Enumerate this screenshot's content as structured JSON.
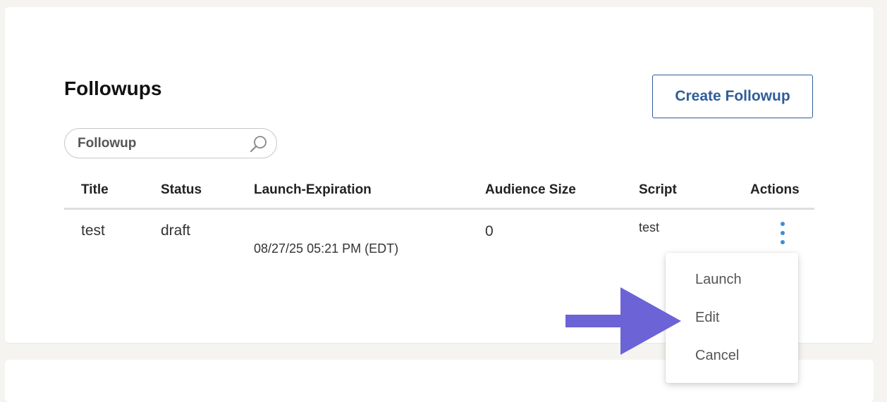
{
  "page": {
    "title": "Followups",
    "create_button_label": "Create Followup"
  },
  "search": {
    "placeholder": "Followup"
  },
  "table": {
    "columns": [
      "Title",
      "Status",
      "Launch-Expiration",
      "Audience Size",
      "Script",
      "Actions"
    ],
    "rows": [
      {
        "title": "test",
        "status": "draft",
        "launch_expiration": "08/27/25 05:21 PM (EDT)",
        "audience_size": "0",
        "script": "test"
      }
    ]
  },
  "actions_menu": {
    "items": [
      "Launch",
      "Edit",
      "Cancel"
    ]
  },
  "colors": {
    "accent": "#2f5d9a",
    "kebab": "#3a8fd8",
    "arrow": "#6b63d6",
    "background": "#f5f4f1"
  },
  "icons": {
    "search": "search-icon",
    "actions": "kebab-menu-icon",
    "pointer": "arrow-right-icon"
  }
}
